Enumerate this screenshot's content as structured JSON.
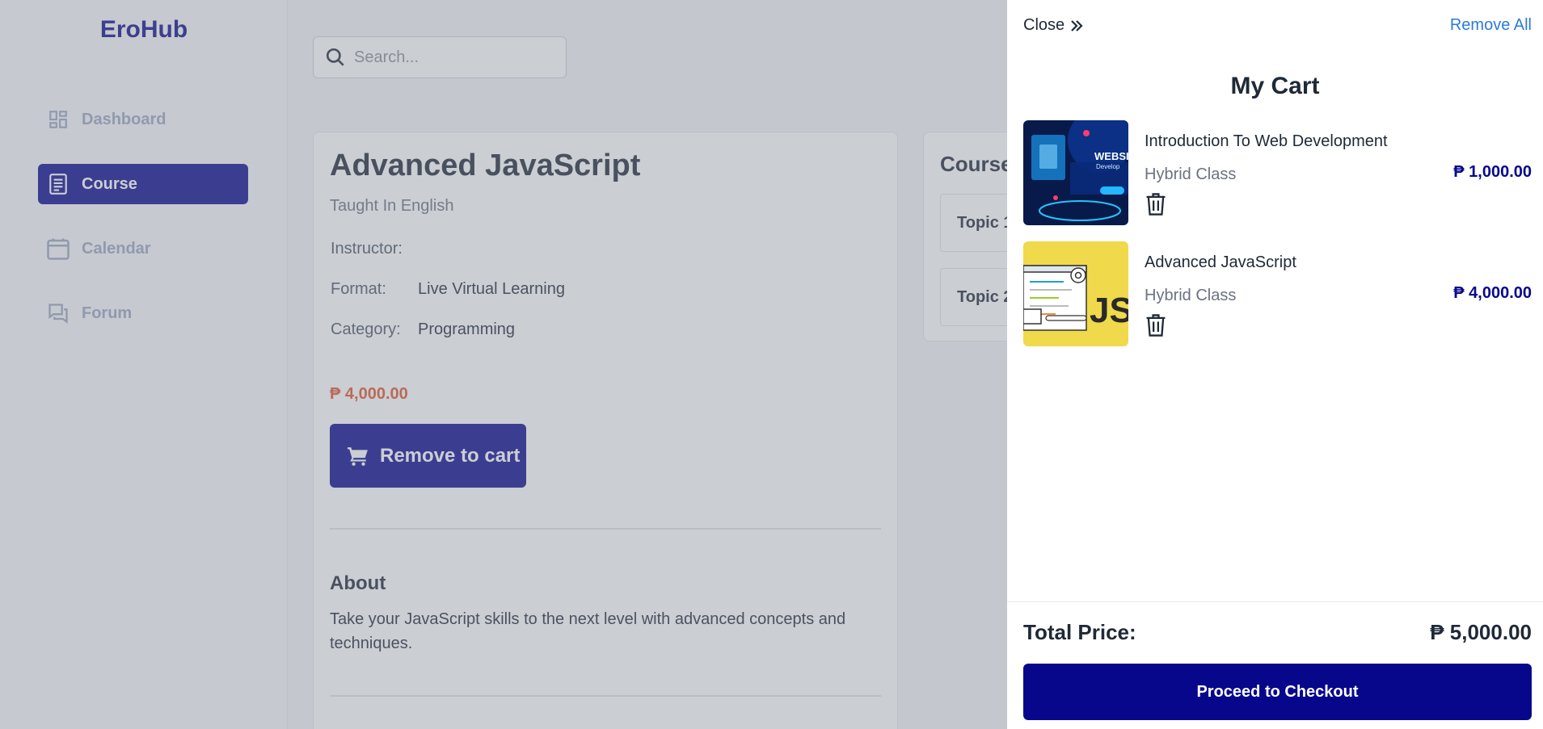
{
  "app": {
    "logo": "EroHub"
  },
  "sidebar": {
    "items": [
      {
        "label": "Dashboard",
        "icon": "dashboard-icon",
        "active": false
      },
      {
        "label": "Course",
        "icon": "document-icon",
        "active": true
      },
      {
        "label": "Calendar",
        "icon": "calendar-icon",
        "active": false
      },
      {
        "label": "Forum",
        "icon": "chat-icon",
        "active": false
      }
    ]
  },
  "search": {
    "placeholder": "Search...",
    "value": ""
  },
  "course": {
    "title": "Advanced JavaScript",
    "language": "Taught In English",
    "instructor_label": "Instructor:",
    "instructor_value": "",
    "format_label": "Format:",
    "format_value": "Live Virtual Learning",
    "category_label": "Category:",
    "category_value": "Programming",
    "price": "₱ 4,000.00",
    "cart_button": "Remove to cart",
    "about_heading": "About",
    "about_text": "Take your JavaScript skills to the next level with advanced concepts and techniques."
  },
  "course_content": {
    "heading": "Course",
    "topics": [
      "Topic 1",
      "Topic 2"
    ]
  },
  "cart": {
    "close_label": "Close",
    "remove_all_label": "Remove All",
    "title": "My Cart",
    "items": [
      {
        "name": "Introduction To Web Development",
        "type": "Hybrid Class",
        "price": "₱ 1,000.00",
        "thumb_text": "WEBSI",
        "thumb_sub": "Develop"
      },
      {
        "name": "Advanced JavaScript",
        "type": "Hybrid Class",
        "price": "₱ 4,000.00",
        "thumb_text": "JS"
      }
    ],
    "total_label": "Total Price:",
    "total_value": "₱ 5,000.00",
    "checkout_label": "Proceed to Checkout"
  },
  "colors": {
    "brand": "#07078c",
    "price_accent": "#e0552b",
    "link": "#2b7bd8"
  }
}
